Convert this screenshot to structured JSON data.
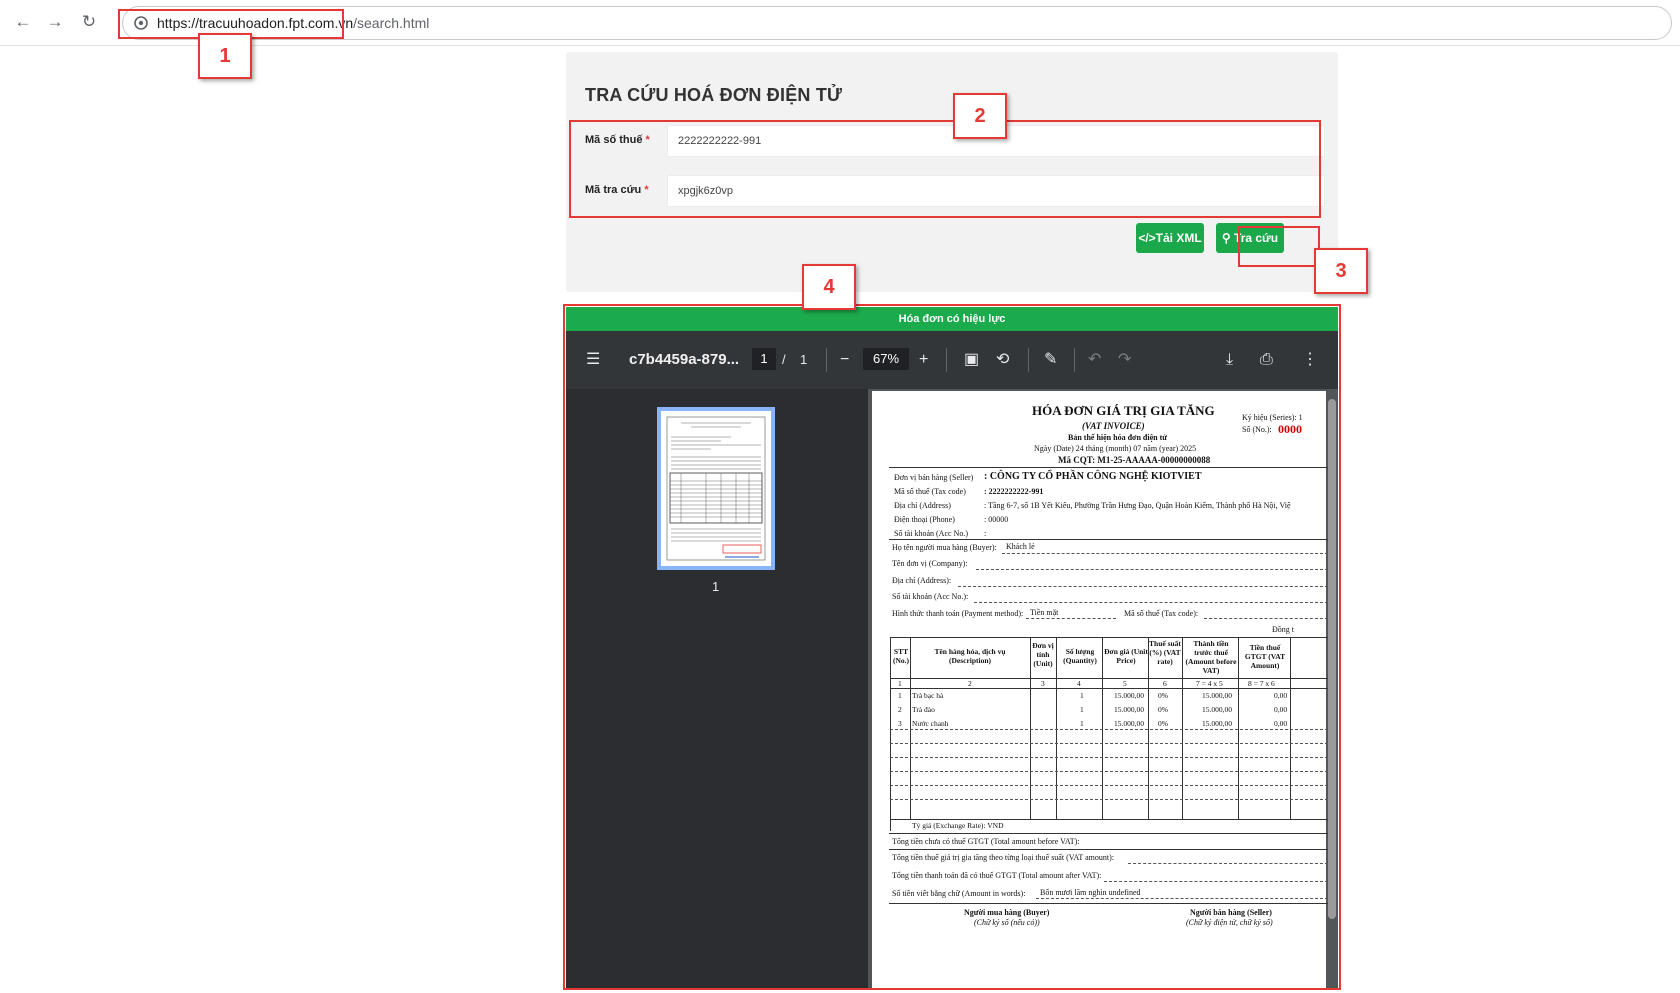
{
  "browser": {
    "url_host": "https://tracuuhoadon.fpt.com.vn",
    "url_path": "/search.html"
  },
  "callouts": [
    "1",
    "2",
    "3",
    "4"
  ],
  "form": {
    "title": "TRA CỨU HOÁ ĐƠN ĐIỆN TỬ",
    "tax_label": "Mã số thuế",
    "tax_value": "2222222222-991",
    "code_label": "Mã tra cứu",
    "code_value": "xpgjk6z0vp",
    "required_mark": "*",
    "xml_button": "Tải XML",
    "search_button": "Tra cứu"
  },
  "status_text": "Hóa đơn có hiệu lực",
  "viewer": {
    "filename": "c7b4459a-879...",
    "page_current": "1",
    "page_sep": "/",
    "page_total": "1",
    "zoom": "67%",
    "thumb_label": "1"
  },
  "invoice": {
    "title": "HÓA ĐƠN GIÁ TRỊ GIA TĂNG",
    "subtitle": "(VAT INVOICE)",
    "note": "Bản thể hiện hóa đơn điện tử",
    "date_line": "Ngày (Date) 24  tháng (month) 07 năm (year)  2025",
    "cqt": "Mã CQT: M1-25-AAAAA-00000000088",
    "series": "Ký hiệu (Series): 1",
    "number_label": "Số (No.):",
    "number": "0000",
    "seller_label": "Đơn vị bán hàng (Seller)",
    "seller": ": CÔNG TY CỔ PHẦN CÔNG NGHỆ KIOTVIET",
    "taxcode_label": "Mã số thuế (Tax code)",
    "taxcode": ": 2222222222-991",
    "address_label": "Địa chỉ (Address)",
    "address": ": Tầng 6-7, số 1B Yết Kiêu, Phường Trần Hưng Đạo, Quận Hoàn Kiếm, Thành phố Hà Nội, Việ",
    "phone_label": "Điện thoại (Phone)",
    "phone": ": 00000",
    "acc_label": "Số tài khoản (Acc No.)",
    "acc": ":",
    "buyer_label": "Họ tên người mua hàng (Buyer):",
    "buyer": "Khách lẻ",
    "company_label": "Tên đơn vị (Company):",
    "baddress_label": "Địa chỉ (Address):",
    "bacc_label": "Số tài khoản (Acc No.):",
    "payment_label": "Hình thức thanh toán (Payment method):",
    "payment": "Tiền mặt",
    "btax_label": "Mã số thuế (Tax code):",
    "currency": "Đồng t",
    "headers": [
      "STT (No.)",
      "Tên hàng hóa, dịch vụ (Description)",
      "Đơn vị tính (Unit)",
      "Số lượng (Quantity)",
      "Đơn giá (Unit Price)",
      "Thuế suất (%) (VAT rate)",
      "Thành tiền trước thuế (Amount before VAT)",
      "Tiền thuế GTGT (VAT Amount)"
    ],
    "index_row": [
      "1",
      "2",
      "3",
      "4",
      "5",
      "6",
      "7 = 4 x 5",
      "8 = 7 x 6"
    ],
    "items": [
      [
        "1",
        "Trà bạc hà",
        "",
        "1",
        "15.000,00",
        "0%",
        "15.000,00",
        "0,00"
      ],
      [
        "2",
        "Trà đào",
        "",
        "1",
        "15.000,00",
        "0%",
        "15.000,00",
        "0,00"
      ],
      [
        "3",
        "Nước chanh",
        "",
        "1",
        "15.000,00",
        "0%",
        "15.000,00",
        "0,00"
      ]
    ],
    "exchange": "Tỷ giá (Exchange Rate): VND",
    "total_before": "Tổng tiền chưa có thuế GTGT (Total amount before VAT):",
    "total_vat": "Tổng tiền thuế giá trị gia tăng theo từng loại thuế suất (VAT amount):",
    "total_after": "Tổng tiền thanh toán đã có thuế GTGT (Total amount after VAT):",
    "words_label": "Số tiền viết bằng chữ (Amount in words):",
    "words": "Bốn mươi lăm nghìn undefined",
    "buyer_sign": "Người mua hàng (Buyer)",
    "buyer_sign_note": "(Chữ ký số (nếu có))",
    "seller_sign": "Người bán hàng (Seller)",
    "seller_sign_note": "(Chữ ký điện tử, chữ ký số)"
  }
}
